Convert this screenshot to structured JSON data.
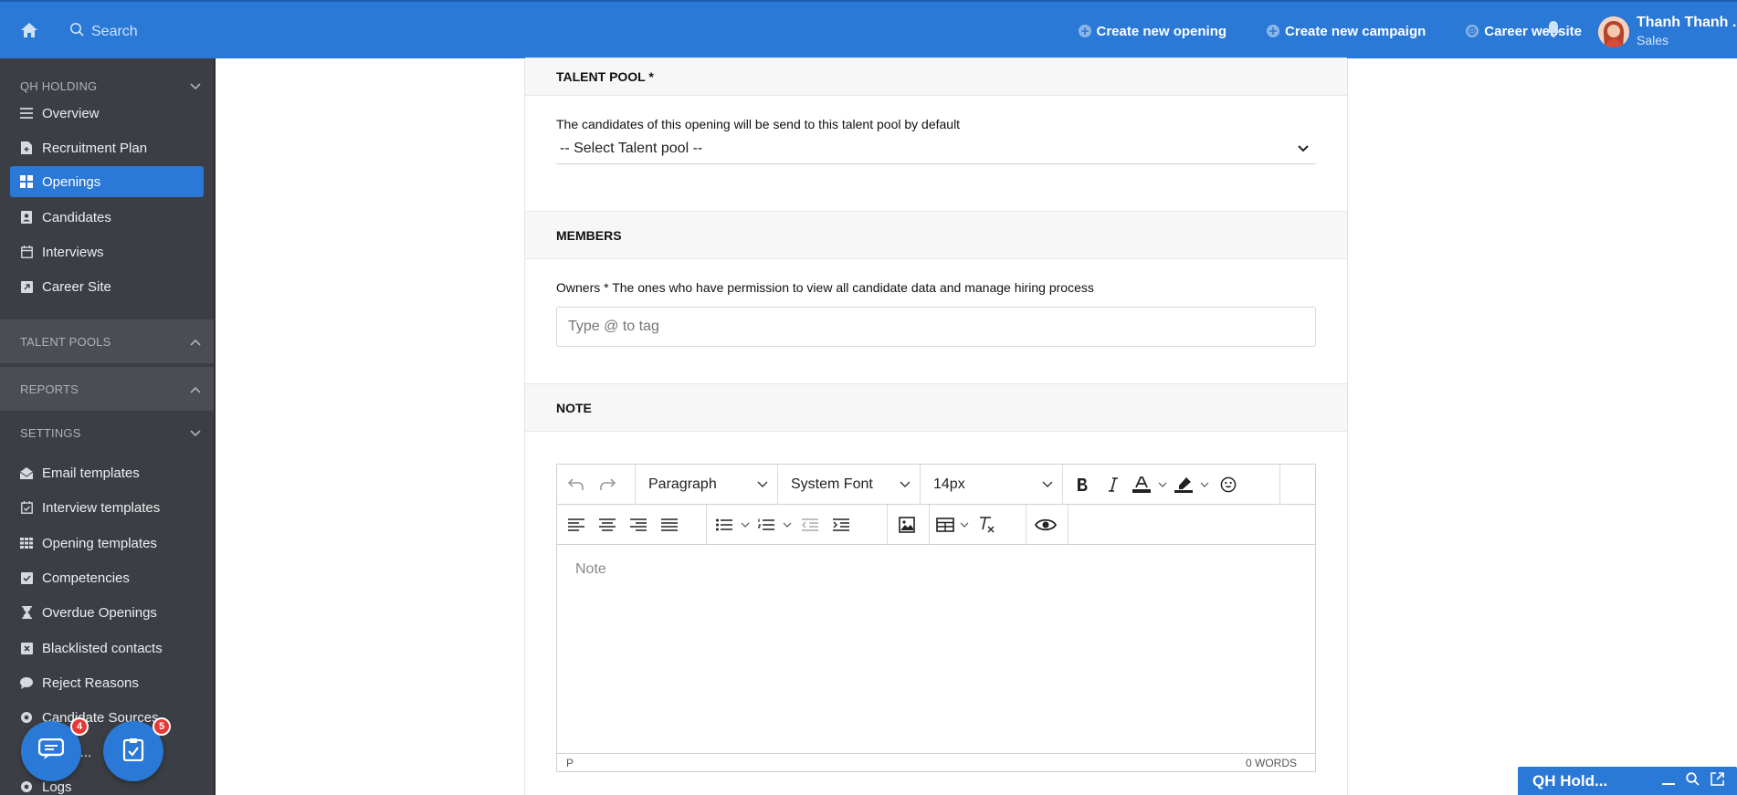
{
  "topbar": {
    "search_placeholder": "Search",
    "actions": [
      {
        "label": "Create new opening",
        "icon": "plus-circle-icon"
      },
      {
        "label": "Create new campaign",
        "icon": "plus-circle-icon"
      },
      {
        "label": "Career website",
        "icon": "globe-icon"
      }
    ],
    "user_name": "Thanh Thanh ...",
    "user_role": "Sales"
  },
  "sidebar": {
    "section_company": "QH HOLDING",
    "items_main": [
      {
        "label": "Overview",
        "icon": "list-icon"
      },
      {
        "label": "Recruitment Plan",
        "icon": "file-plus-icon"
      },
      {
        "label": "Openings",
        "icon": "grid-icon",
        "active": true
      },
      {
        "label": "Candidates",
        "icon": "contact-card-icon"
      },
      {
        "label": "Interviews",
        "icon": "calendar-icon"
      },
      {
        "label": "Career Site",
        "icon": "external-square-icon"
      }
    ],
    "section_talent": "TALENT POOLS",
    "section_reports": "REPORTS",
    "section_settings": "SETTINGS",
    "items_settings": [
      {
        "label": "Email templates",
        "icon": "envelope-open-icon"
      },
      {
        "label": "Interview templates",
        "icon": "calendar-check-icon"
      },
      {
        "label": "Opening templates",
        "icon": "grid-dots-icon"
      },
      {
        "label": "Competencies",
        "icon": "check-square-icon"
      },
      {
        "label": "Overdue Openings",
        "icon": "hourglass-icon"
      },
      {
        "label": "Blacklisted contacts",
        "icon": "x-square-icon"
      },
      {
        "label": "Reject Reasons",
        "icon": "comment-icon"
      },
      {
        "label": "Candidate Sources",
        "icon": "eye-icon"
      },
      {
        "label": "Test S...",
        "icon": "eye-icon"
      },
      {
        "label": "Logs",
        "icon": "eye-icon"
      }
    ]
  },
  "fabs": {
    "chat_badge": "4",
    "tasks_badge": "5"
  },
  "form": {
    "talent_pool_title": "TALENT POOL *",
    "talent_pool_desc": "The candidates of this opening will be send to this talent pool by default",
    "talent_pool_select": "-- Select Talent pool --",
    "members_title": "MEMBERS",
    "owners_label": "Owners * The ones who have permission to view all candidate data and manage hiring process",
    "owners_placeholder": "Type @ to tag",
    "note_title": "NOTE",
    "editor": {
      "block_format": "Paragraph",
      "font_family": "System Font",
      "font_size": "14px",
      "placeholder": "Note",
      "status_path": "P",
      "word_count": "0 WORDS"
    }
  },
  "chat_widget": {
    "title": "QH Hold..."
  }
}
